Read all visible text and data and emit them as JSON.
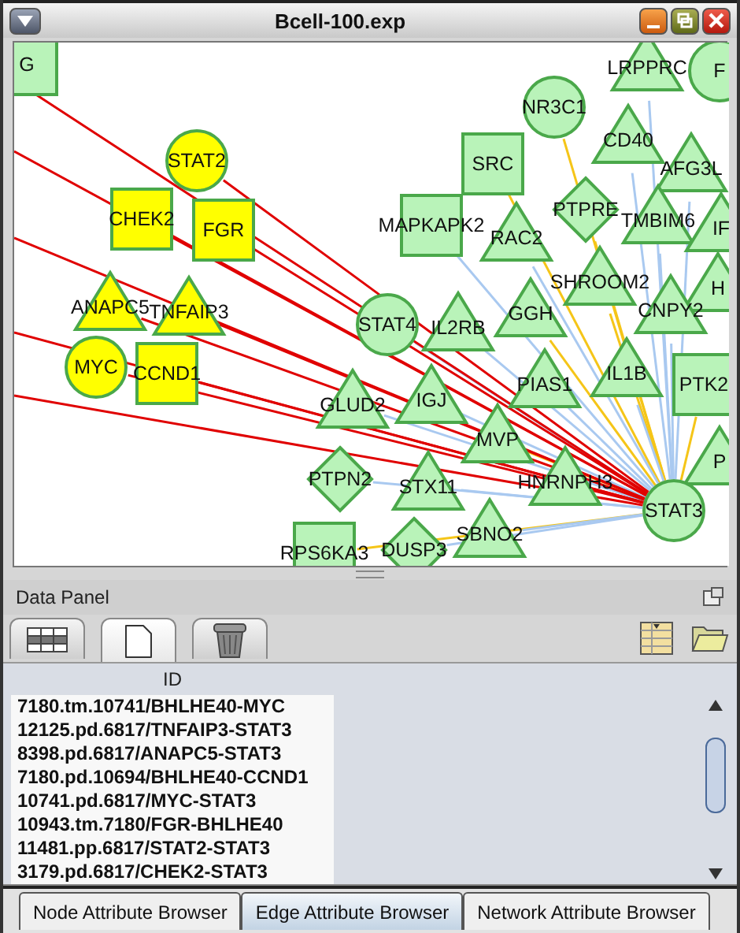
{
  "window": {
    "title": "Bcell-100.exp"
  },
  "network": {
    "nodes": [
      {
        "label": "G",
        "kind": "square",
        "selected": false
      },
      {
        "label": "LRPPRC",
        "kind": "triangle",
        "selected": false
      },
      {
        "label": "F",
        "kind": "circle",
        "selected": false
      },
      {
        "label": "NR3C1",
        "kind": "circle",
        "selected": false
      },
      {
        "label": "CD40",
        "kind": "triangle",
        "selected": false
      },
      {
        "label": "STAT2",
        "kind": "circle",
        "selected": true
      },
      {
        "label": "SRC",
        "kind": "square",
        "selected": false
      },
      {
        "label": "AFG3L",
        "kind": "triangle",
        "selected": false
      },
      {
        "label": "CHEK2",
        "kind": "square",
        "selected": true
      },
      {
        "label": "FGR",
        "kind": "square",
        "selected": true
      },
      {
        "label": "MAPKAPK2",
        "kind": "square",
        "selected": false
      },
      {
        "label": "RAC2",
        "kind": "triangle",
        "selected": false
      },
      {
        "label": "PTPRE",
        "kind": "diamond",
        "selected": false
      },
      {
        "label": "TMBIM6",
        "kind": "triangle",
        "selected": false
      },
      {
        "label": "IF",
        "kind": "triangle",
        "selected": false
      },
      {
        "label": "SHROOM2",
        "kind": "triangle",
        "selected": false
      },
      {
        "label": "H",
        "kind": "triangle",
        "selected": false
      },
      {
        "label": "ANAPC5",
        "kind": "triangle",
        "selected": true
      },
      {
        "label": "TNFAIP3",
        "kind": "triangle",
        "selected": true
      },
      {
        "label": "STAT4",
        "kind": "circle",
        "selected": false
      },
      {
        "label": "IL2RB",
        "kind": "triangle",
        "selected": false
      },
      {
        "label": "GGH",
        "kind": "triangle",
        "selected": false
      },
      {
        "label": "CNPY2",
        "kind": "triangle",
        "selected": false
      },
      {
        "label": "MYC",
        "kind": "circle",
        "selected": true
      },
      {
        "label": "CCND1",
        "kind": "square",
        "selected": true
      },
      {
        "label": "PIAS1",
        "kind": "triangle",
        "selected": false
      },
      {
        "label": "IL1B",
        "kind": "triangle",
        "selected": false
      },
      {
        "label": "PTK2",
        "kind": "square",
        "selected": false
      },
      {
        "label": "GLUD2",
        "kind": "triangle",
        "selected": false
      },
      {
        "label": "IGJ",
        "kind": "triangle",
        "selected": false
      },
      {
        "label": "MVP",
        "kind": "triangle",
        "selected": false
      },
      {
        "label": "PTPN2",
        "kind": "diamond",
        "selected": false
      },
      {
        "label": "STX11",
        "kind": "triangle",
        "selected": false
      },
      {
        "label": "HNRNPH3",
        "kind": "triangle",
        "selected": false
      },
      {
        "label": "P",
        "kind": "triangle",
        "selected": false
      },
      {
        "label": "STAT3",
        "kind": "circle",
        "selected": false
      },
      {
        "label": "RPS6KA3",
        "kind": "square",
        "selected": false
      },
      {
        "label": "DUSP3",
        "kind": "diamond",
        "selected": false
      },
      {
        "label": "SBNO2",
        "kind": "triangle",
        "selected": false
      }
    ]
  },
  "data_panel": {
    "title": "Data Panel",
    "toolbar_tabs": [
      {
        "kind": "grid",
        "selected": false
      },
      {
        "kind": "page",
        "selected": true
      },
      {
        "kind": "trash",
        "selected": false
      }
    ],
    "table": {
      "columns": [
        "ID"
      ],
      "rows": [
        "7180.tm.10741/BHLHE40-MYC",
        "12125.pd.6817/TNFAIP3-STAT3",
        "8398.pd.6817/ANAPC5-STAT3",
        "7180.pd.10694/BHLHE40-CCND1",
        "10741.pd.6817/MYC-STAT3",
        "10943.tm.7180/FGR-BHLHE40",
        "11481.pp.6817/STAT2-STAT3",
        "3179.pd.6817/CHEK2-STAT3"
      ]
    }
  },
  "browser_tabs": [
    {
      "label": "Node Attribute Browser",
      "selected": false
    },
    {
      "label": "Edge Attribute Browser",
      "selected": true
    },
    {
      "label": "Network Attribute Browser",
      "selected": false
    }
  ]
}
